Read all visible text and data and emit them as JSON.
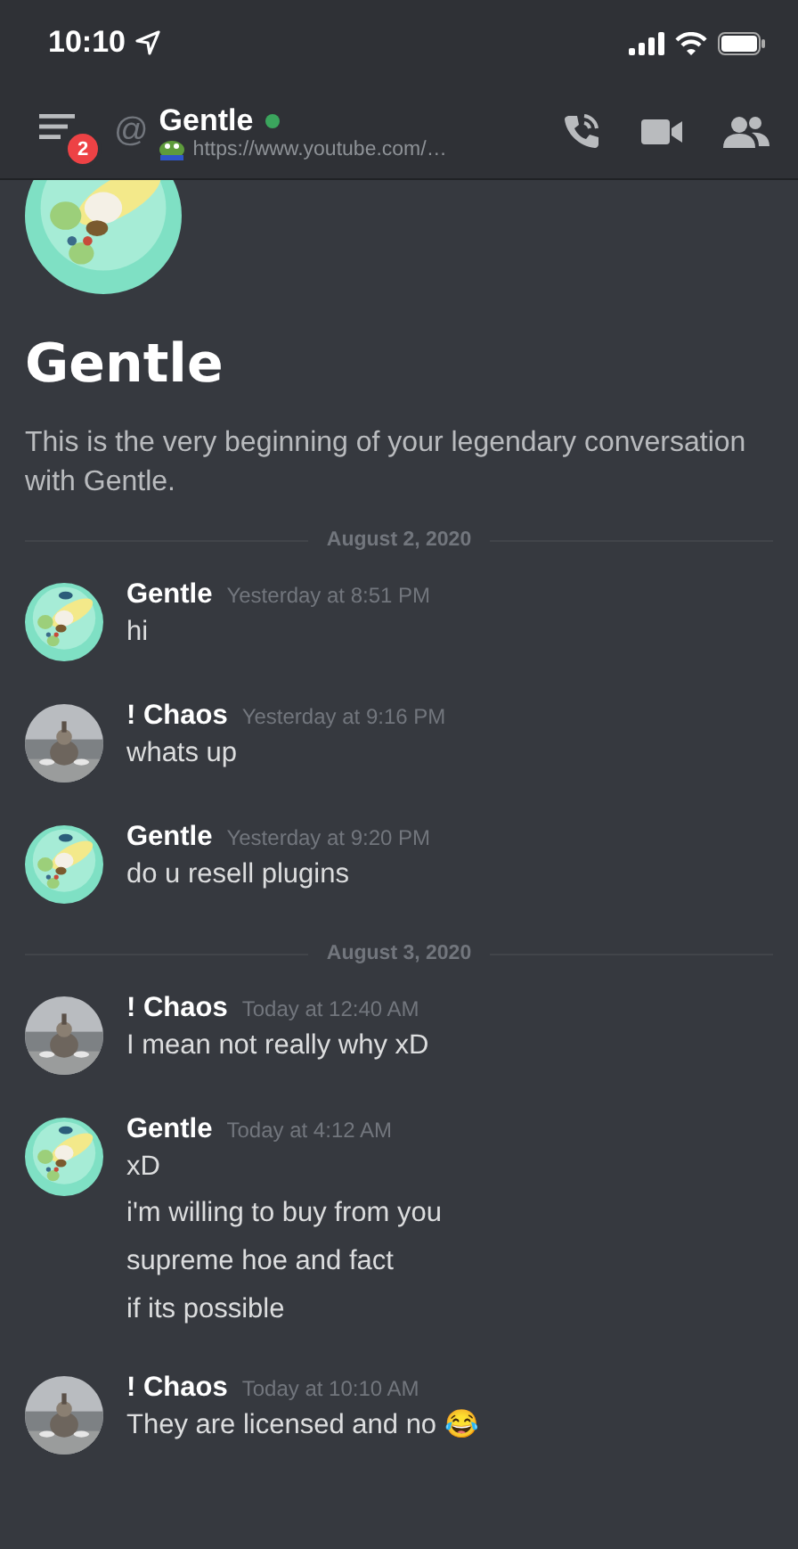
{
  "status_bar": {
    "time": "10:10"
  },
  "header": {
    "badge": "2",
    "at": "@",
    "title": "Gentle",
    "online": true,
    "subtitle": "https://www.youtube.com/…"
  },
  "intro": {
    "title": "Gentle",
    "text": "This is the very beginning of your legendary conversation with Gentle."
  },
  "feed": [
    {
      "kind": "divider",
      "label": "August 2, 2020"
    },
    {
      "kind": "message",
      "author": "Gentle",
      "time": "Yesterday at 8:51 PM",
      "lines": [
        "hi"
      ]
    },
    {
      "kind": "message",
      "author": "! Chaos",
      "time": "Yesterday at 9:16 PM",
      "lines": [
        "whats up"
      ]
    },
    {
      "kind": "message",
      "author": "Gentle",
      "time": "Yesterday at 9:20 PM",
      "lines": [
        "do u resell plugins"
      ]
    },
    {
      "kind": "divider",
      "label": "August 3, 2020"
    },
    {
      "kind": "message",
      "author": "! Chaos",
      "time": "Today at 12:40 AM",
      "lines": [
        "I mean not really why xD"
      ]
    },
    {
      "kind": "message",
      "author": "Gentle",
      "time": "Today at 4:12 AM",
      "lines": [
        "xD",
        "i'm willing to buy from you",
        "supreme hoe and fact",
        "if its possible"
      ]
    },
    {
      "kind": "message",
      "author": "! Chaos",
      "time": "Today at 10:10 AM",
      "lines": [
        "They are licensed and no 😂"
      ]
    }
  ]
}
